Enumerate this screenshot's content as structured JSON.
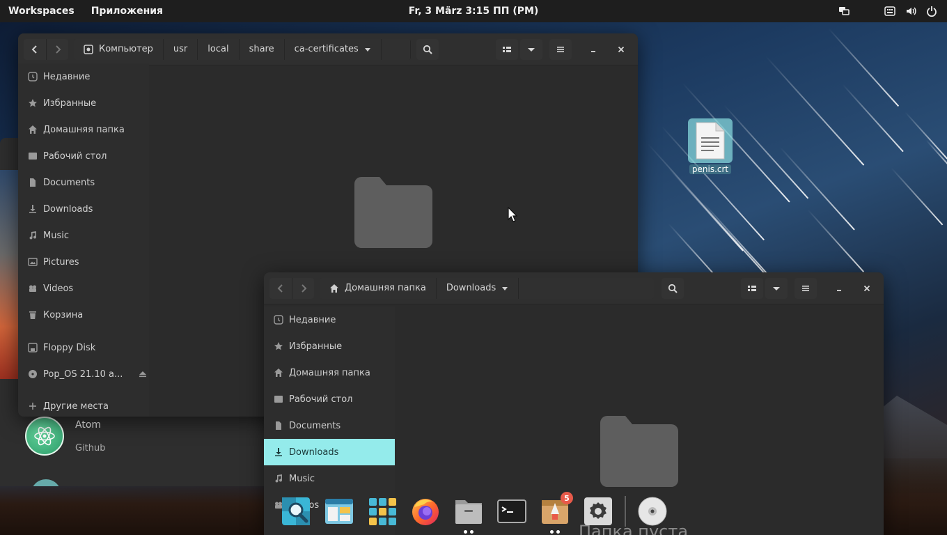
{
  "top_panel": {
    "workspaces": "Workspaces",
    "applications": "Приложения",
    "clock": "Fr, 3 März   3:15 ПП (PM)"
  },
  "background_app": {
    "app_name": "Atom",
    "app_category": "Github"
  },
  "window1": {
    "breadcrumbs": [
      "Компьютер",
      "usr",
      "local",
      "share",
      "ca-certificates"
    ],
    "sidebar": [
      "Недавние",
      "Избранные",
      "Домашняя папка",
      "Рабочий стол",
      "Documents",
      "Downloads",
      "Music",
      "Pictures",
      "Videos",
      "Корзина",
      "Floppy Disk",
      "Pop_OS 21.10 a...",
      "Другие места"
    ]
  },
  "window2": {
    "breadcrumbs": [
      "Домашняя папка",
      "Downloads"
    ],
    "sidebar": [
      "Недавние",
      "Избранные",
      "Домашняя папка",
      "Рабочий стол",
      "Documents",
      "Downloads",
      "Music",
      "Videos"
    ],
    "active_item": "Downloads",
    "empty_text": "Папка пуста"
  },
  "desktop": {
    "file_label": "penis.crt"
  },
  "dock": {
    "badge_count": "5",
    "apps": [
      "magnifier-icon",
      "files-window-icon",
      "app-grid-icon",
      "firefox-icon",
      "file-manager-icon",
      "terminal-icon",
      "pop-shop-icon",
      "settings-icon",
      "disc-icon"
    ]
  },
  "colors": {
    "accent": "#94ebeb",
    "panel": "#1e1e1e",
    "window": "#2b2b2b",
    "badge": "#e85a4a"
  }
}
